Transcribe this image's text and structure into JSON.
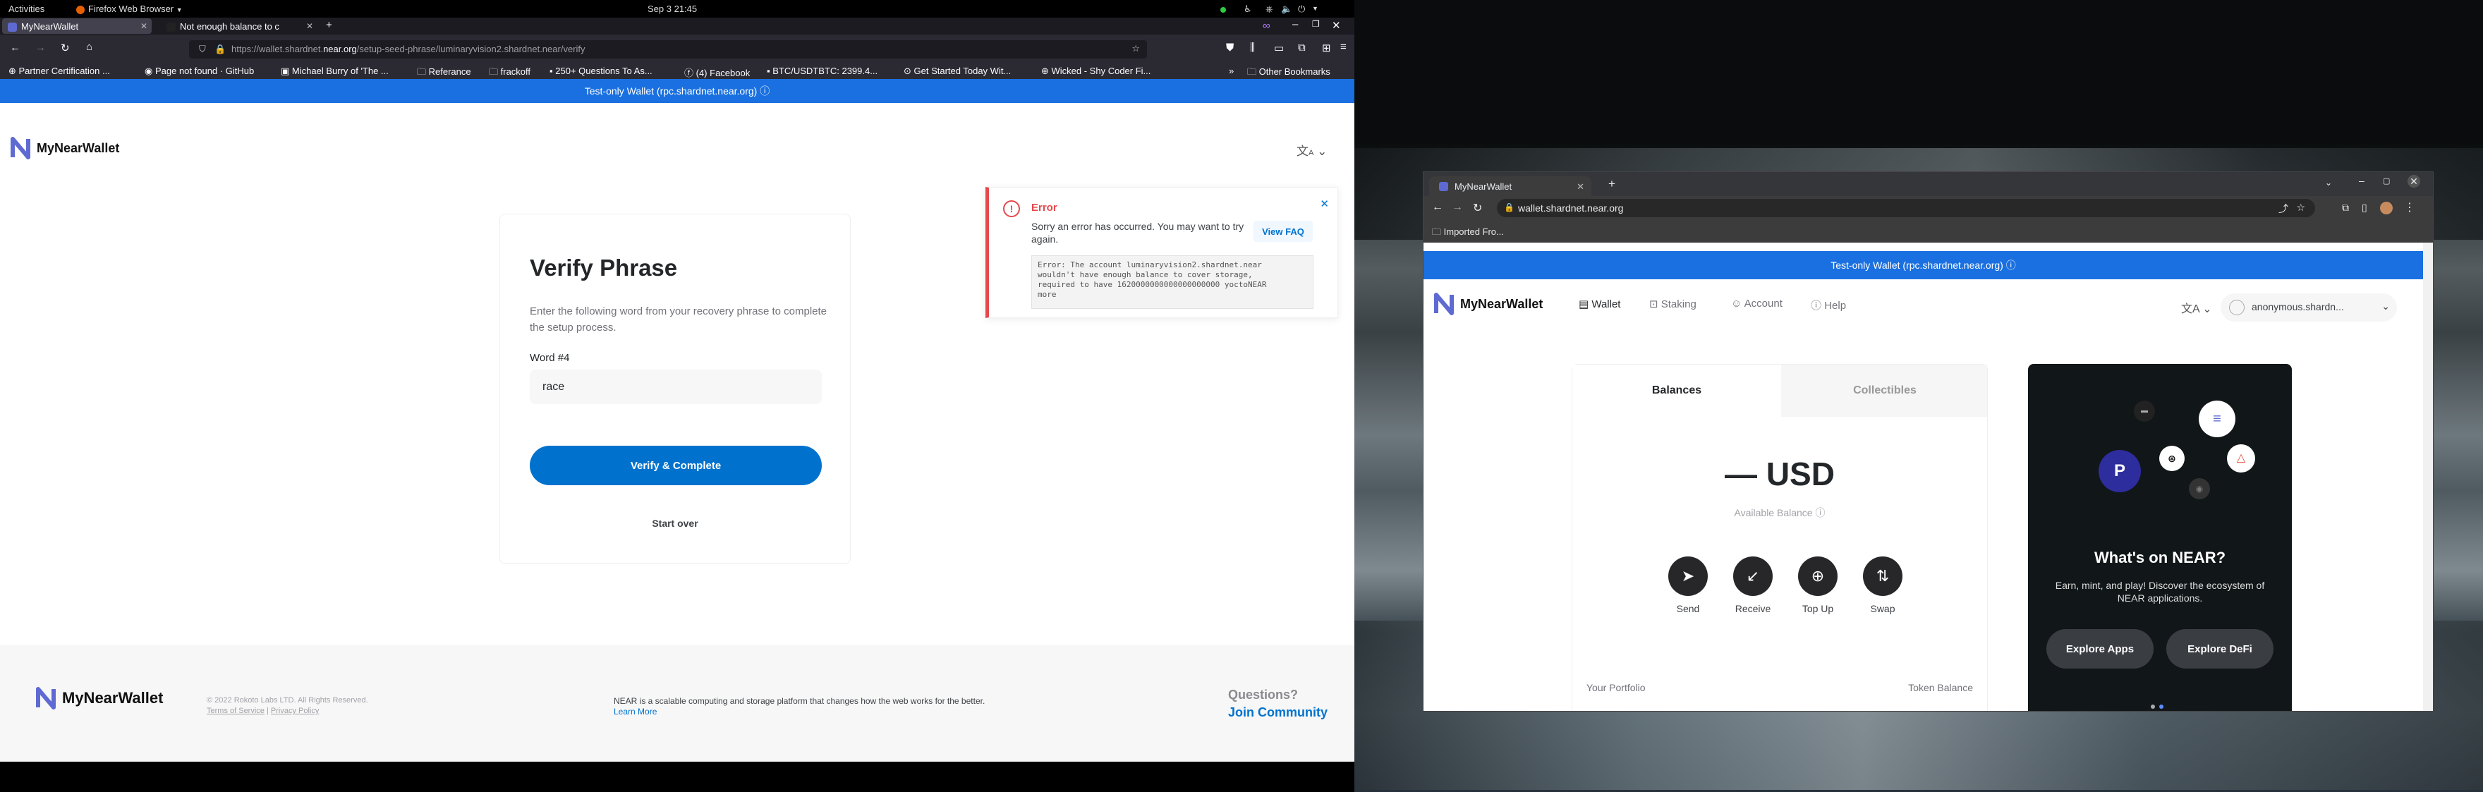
{
  "topbar": {
    "activities": "Activities",
    "app_menu": "Firefox Web Browser",
    "clock": "Sep 3  21:45"
  },
  "firefox": {
    "tabs": [
      {
        "title": "MyNearWallet"
      },
      {
        "title": "Not enough balance to c"
      }
    ],
    "url_prefix": "https://wallet.shardnet.",
    "url_domain": "near.org",
    "url_path": "/setup-seed-phrase/luminaryvision2.shardnet.near/verify",
    "bookmarks": [
      "Partner Certification ...",
      "Page not found · GitHub",
      "Michael Burry of 'The ...",
      "Referance",
      "frackoff",
      "250+ Questions To As...",
      "(4) Facebook",
      "BTC/USDTBTC: 2399.4...",
      "Get Started Today Wit...",
      "Wicked - Shy Coder Fi..."
    ],
    "other_bookmarks": "Other Bookmarks",
    "banner": "Test-only Wallet  (rpc.shardnet.near.org)",
    "brand": "MyNearWallet",
    "verify": {
      "title": "Verify Phrase",
      "description": "Enter the following word from your recovery phrase to complete the setup process.",
      "word_label": "Word #4",
      "word_value": "race",
      "button": "Verify & Complete",
      "start_over": "Start over"
    },
    "error": {
      "title": "Error",
      "message": "Sorry an error has occurred. You may want to try again.",
      "faq_button": "View FAQ",
      "detail": "Error: The account luminaryvision2.shardnet.near\nwouldn't have enough balance to cover storage,\nrequired to have 1620000000000000000000 yoctoNEAR\nmore"
    },
    "footer": {
      "copyright": "© 2022 Rokoto Labs LTD. All Rights Reserved.",
      "terms": "Terms of Service",
      "privacy": "Privacy Policy",
      "blurb": "NEAR is a scalable computing and storage platform that changes how the web works for the better.",
      "learn_more": "Learn More",
      "questions": "Questions?",
      "community": "Join Community"
    }
  },
  "chrome": {
    "tab_title": "MyNearWallet",
    "url": "wallet.shardnet.near.org",
    "bookmark": "Imported Fro...",
    "banner": "Test-only Wallet  (rpc.shardnet.near.org)",
    "brand": "MyNearWallet",
    "nav": [
      "Wallet",
      "Staking",
      "Account",
      "Help"
    ],
    "account": "anonymous.shardn...",
    "balances_tab": "Balances",
    "collectibles_tab": "Collectibles",
    "balance": "— USD",
    "available": "Available Balance",
    "actions": [
      "Send",
      "Receive",
      "Top Up",
      "Swap"
    ],
    "portfolio": "Your Portfolio",
    "token_balance": "Token Balance",
    "promo": {
      "title": "What's on NEAR?",
      "text": "Earn, mint, and play! Discover the ecosystem of NEAR applications.",
      "apps": "Explore Apps",
      "defi": "Explore DeFi"
    }
  },
  "colors": {
    "accent": "#0072ce",
    "banner": "#1a70e0",
    "error": "#e5484d"
  }
}
